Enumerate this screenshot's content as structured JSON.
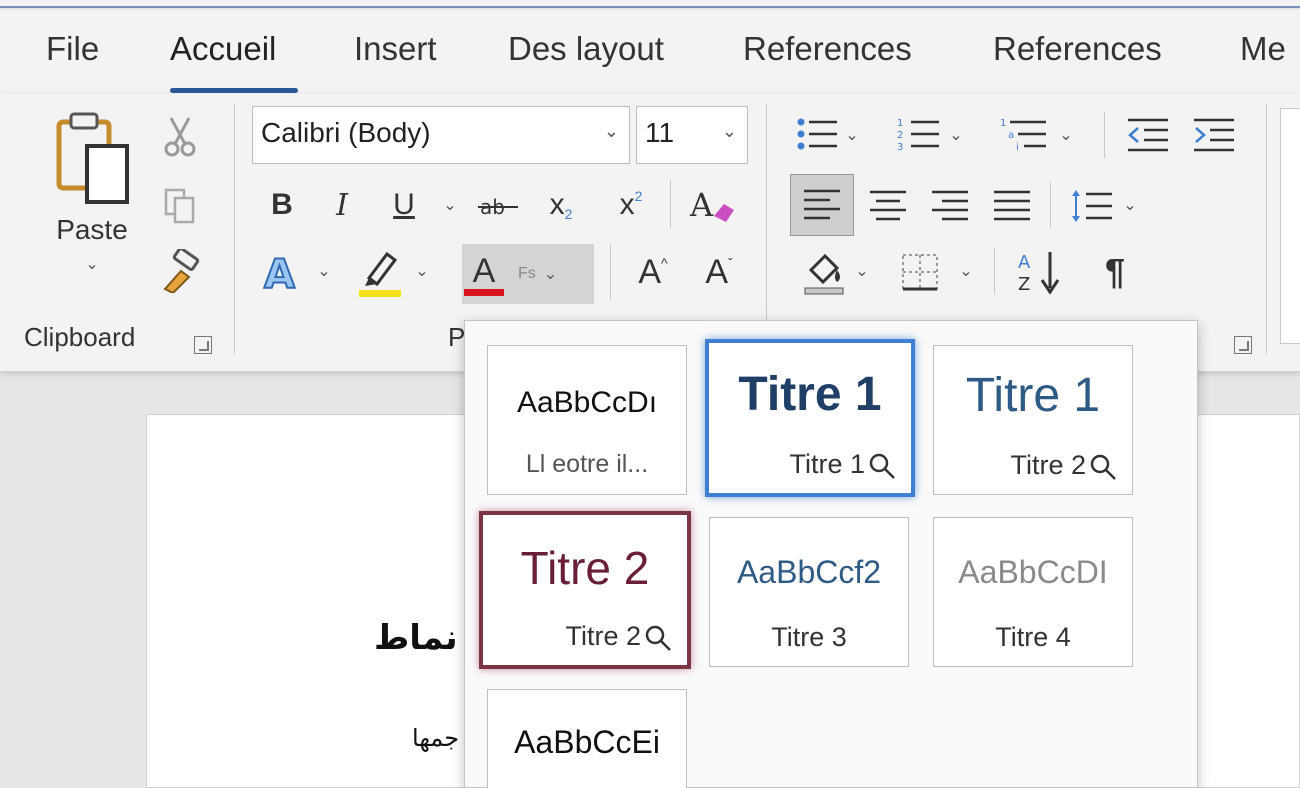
{
  "tabs": {
    "file": "File",
    "home": "Accueil",
    "insert": "Insert",
    "design": "Des layout",
    "references1": "References",
    "references2": "References",
    "more": "Me"
  },
  "clipboard": {
    "paste_label": "Paste",
    "group_label": "Clipboard"
  },
  "font": {
    "family": "Calibri (Body)",
    "size": "11",
    "bold": "B",
    "italic": "I",
    "underline": "U",
    "subscript": "x",
    "superscript": "x",
    "grow": "A",
    "shrink": "A",
    "color_letter": "A",
    "group_label": "P"
  },
  "paragraph": {
    "show_marks": "¶"
  },
  "colors": {
    "accent": "#2b579a",
    "highlight": "#f5e11a",
    "font_color": "#d9141c",
    "heading1": "#1f3f66",
    "heading2_tile_border": "#7c3346",
    "heading1_tile_border": "#3f7fd1",
    "titre2_text": "#6b1e3a",
    "aabb_blue": "#2e5b86",
    "aabb_gray": "#8a8a8a"
  },
  "gallery": {
    "tiles": [
      {
        "preview": "AaBbCcDı",
        "name": "Ll eotre il..."
      },
      {
        "preview": "Titre 1",
        "name": "Titre 1"
      },
      {
        "preview": "Titre 1",
        "name": "Titre 2"
      },
      {
        "preview": "Titre 2",
        "name": "Titre 2"
      },
      {
        "preview": "AaBbCcf2",
        "name": "Titre 3"
      },
      {
        "preview": "AaBbCcDI",
        "name": "Titre 4"
      },
      {
        "preview": "AaBbCcEi",
        "name": ""
      }
    ]
  },
  "document": {
    "heading": "نماط",
    "text": "جمها"
  }
}
